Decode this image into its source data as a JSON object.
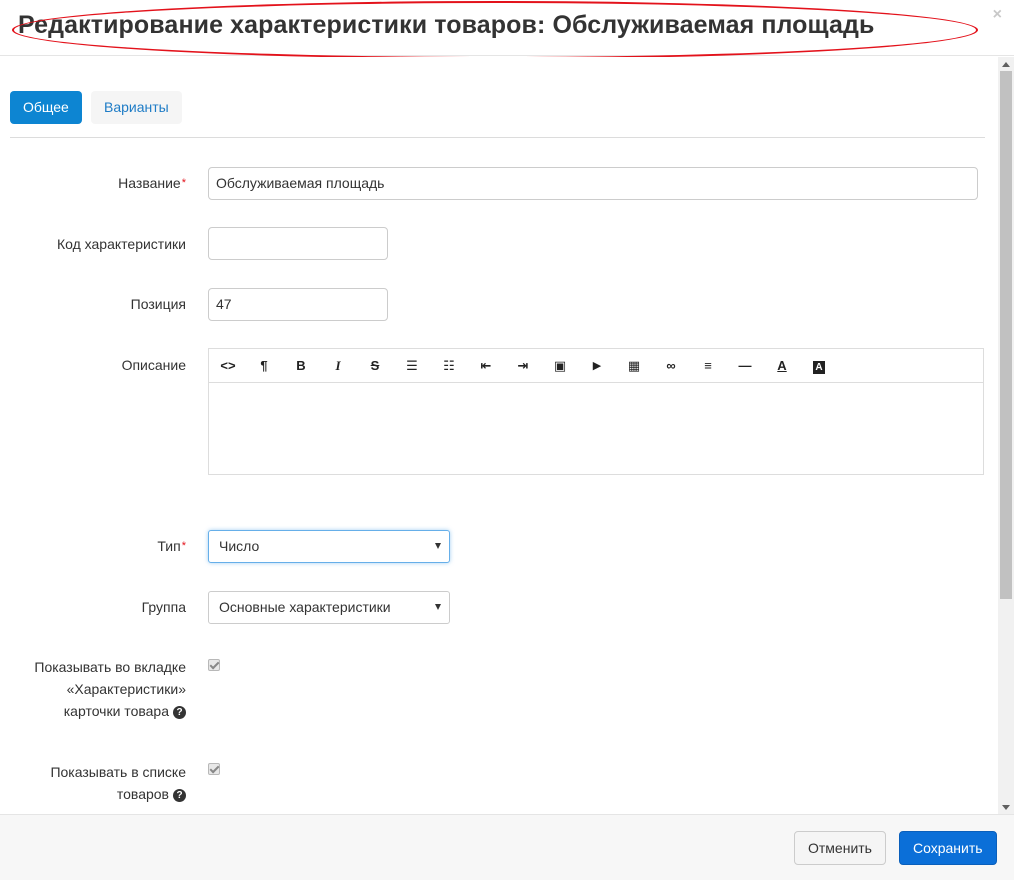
{
  "header": {
    "title": "Редактирование характеристики товаров: Обслуживаемая площадь",
    "close_glyph": "×"
  },
  "tabs": [
    {
      "label": "Общее",
      "active": true
    },
    {
      "label": "Варианты",
      "active": false
    }
  ],
  "form": {
    "name": {
      "label": "Название",
      "required_mark": "*",
      "value": "Обслуживаемая площадь"
    },
    "code": {
      "label": "Код характеристики",
      "value": ""
    },
    "position": {
      "label": "Позиция",
      "value": "47"
    },
    "description": {
      "label": "Описание",
      "toolbar": [
        {
          "icon": "html-code-icon",
          "glyph": "<>"
        },
        {
          "icon": "paragraph-icon",
          "glyph": "¶"
        },
        {
          "icon": "bold-icon",
          "glyph": "B"
        },
        {
          "icon": "italic-icon",
          "glyph": "I"
        },
        {
          "icon": "strikethrough-icon",
          "glyph": "S"
        },
        {
          "icon": "unordered-list-icon",
          "glyph": "☰"
        },
        {
          "icon": "ordered-list-icon",
          "glyph": "☷"
        },
        {
          "icon": "outdent-icon",
          "glyph": "⇤"
        },
        {
          "icon": "indent-icon",
          "glyph": "⇥"
        },
        {
          "icon": "image-icon",
          "glyph": "▣"
        },
        {
          "icon": "video-icon",
          "glyph": "▶"
        },
        {
          "icon": "table-icon",
          "glyph": "▦"
        },
        {
          "icon": "link-icon",
          "glyph": "∞"
        },
        {
          "icon": "align-icon",
          "glyph": "≡"
        },
        {
          "icon": "horizontal-rule-icon",
          "glyph": "—"
        },
        {
          "icon": "font-color-icon",
          "glyph": "A"
        },
        {
          "icon": "background-color-icon",
          "glyph": "A"
        }
      ],
      "value": ""
    },
    "type": {
      "label": "Тип",
      "required_mark": "*",
      "selected": "Число"
    },
    "group": {
      "label": "Группа",
      "selected": "Основные характеристики"
    },
    "show_in_tab": {
      "label_lines": [
        "Показывать во вкладке",
        "«Характеристики»",
        "карточки товара"
      ],
      "checked": true
    },
    "show_in_list": {
      "label_lines": [
        "Показывать в списке",
        "товаров"
      ],
      "checked": true
    },
    "help_glyph": "?"
  },
  "footer": {
    "cancel_label": "Отменить",
    "save_label": "Сохранить"
  },
  "colors": {
    "primary": "#0d85d2",
    "save": "#0b6fd8",
    "required": "#e3121b",
    "annotation": "#e3121b"
  }
}
